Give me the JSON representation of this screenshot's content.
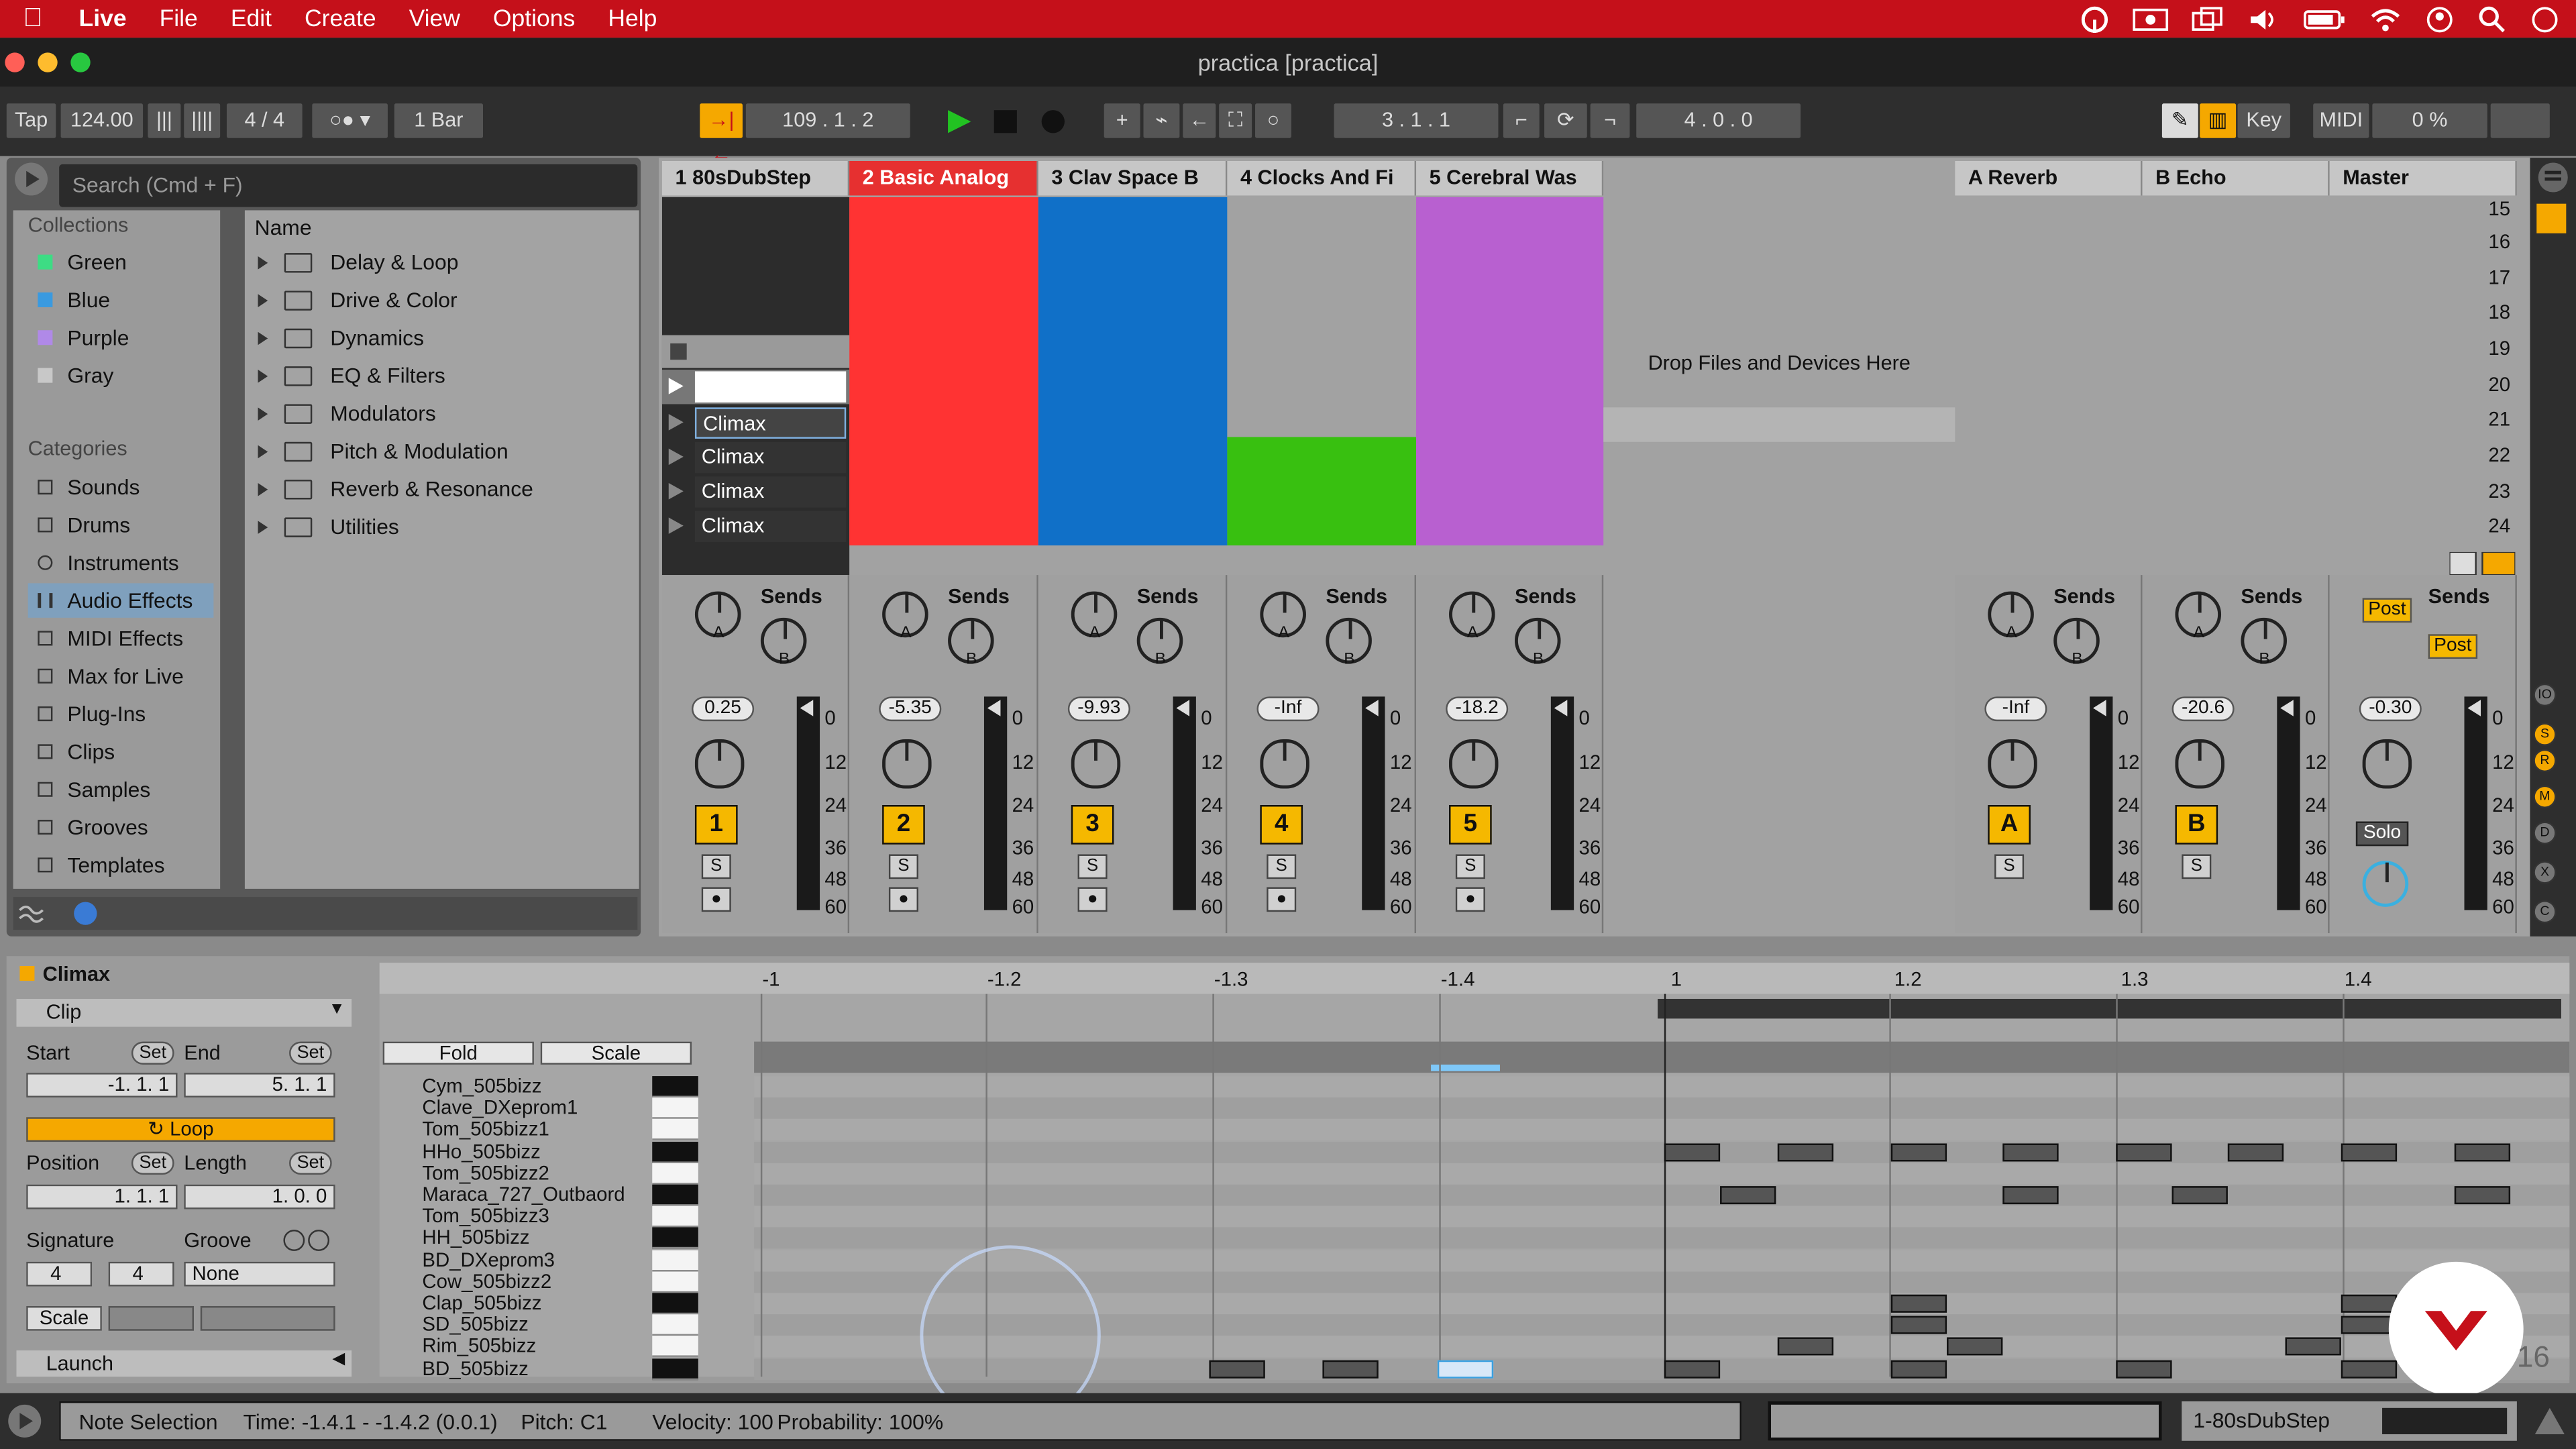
{
  "menubar": {
    "app": "Live",
    "items": [
      "File",
      "Edit",
      "Create",
      "View",
      "Options",
      "Help"
    ]
  },
  "window": {
    "title": "practica  [practica]"
  },
  "control_bar": {
    "tap": "Tap",
    "tempo": "124.00",
    "signature": "4 / 4",
    "quantize": "1 Bar",
    "position": "109 .  1 .  2",
    "loop_start": "3 .  1 .  1",
    "loop_length": "4 .  0 .  0",
    "key": "Key",
    "midi": "MIDI",
    "cpu": "0 %"
  },
  "browser": {
    "search_placeholder": "Search (Cmd + F)",
    "collections_title": "Collections",
    "collections": [
      {
        "label": "Green",
        "color": "#3ddc84"
      },
      {
        "label": "Blue",
        "color": "#3a9ae0"
      },
      {
        "label": "Purple",
        "color": "#b089e8"
      },
      {
        "label": "Gray",
        "color": "#c8c8c8"
      }
    ],
    "categories_title": "Categories",
    "categories": [
      "Sounds",
      "Drums",
      "Instruments",
      "Audio Effects",
      "MIDI Effects",
      "Max for Live",
      "Plug-Ins",
      "Clips",
      "Samples",
      "Grooves",
      "Templates"
    ],
    "selected_category": "Audio Effects",
    "name_header": "Name",
    "folders": [
      "Delay & Loop",
      "Drive & Color",
      "Dynamics",
      "EQ & Filters",
      "Modulators",
      "Pitch & Modulation",
      "Reverb & Resonance",
      "Utilities"
    ]
  },
  "session": {
    "tracks": [
      {
        "name": "1 80sDubStep",
        "volume": "0.25",
        "number": "1"
      },
      {
        "name": "2 Basic Analog",
        "volume": "-5.35",
        "number": "2"
      },
      {
        "name": "3 Clav Space B",
        "volume": "-9.93",
        "number": "3"
      },
      {
        "name": "4 Clocks And Fi",
        "volume": "-Inf",
        "number": "4"
      },
      {
        "name": "5 Cerebral Was",
        "volume": "-18.2",
        "number": "5"
      }
    ],
    "clip_names": [
      "Climax",
      "Climax",
      "Climax",
      "Climax"
    ],
    "drop_text": "Drop Files and Devices Here",
    "returns": [
      {
        "name": "A Reverb",
        "volume": "-Inf",
        "letter": "A"
      },
      {
        "name": "B Echo",
        "volume": "-20.6",
        "letter": "B"
      }
    ],
    "master": {
      "name": "Master",
      "volume": "-0.30",
      "solo": "Solo",
      "post1": "Post",
      "post2": "Post"
    },
    "scene_numbers": [
      "15",
      "16",
      "17",
      "18",
      "19",
      "20",
      "21",
      "22",
      "23",
      "24"
    ],
    "sends": "Sends",
    "meter_scale": [
      "0",
      "12",
      "24",
      "36",
      "48",
      "60"
    ],
    "solo_btn": "S"
  },
  "clip_detail": {
    "clip_name": "Climax",
    "clip_header": "Clip",
    "start_label": "Start",
    "end_label": "End",
    "set": "Set",
    "start_value": "-1.  1.  1",
    "end_value": "5.  1.  1",
    "loop": "Loop",
    "position_label": "Position",
    "length_label": "Length",
    "position_value": "1.  1.  1",
    "length_value": "1.  0.  0",
    "signature_label": "Signature",
    "groove_label": "Groove",
    "sig_num": "4",
    "sig_den": "4",
    "groove_value": "None",
    "scale_btn": "Scale",
    "launch": "Launch"
  },
  "piano_roll": {
    "fold": "Fold",
    "scale": "Scale",
    "ruler": [
      "-1",
      "-1.2",
      "-1.3",
      "-1.4",
      "1",
      "1.2",
      "1.3",
      "1.4"
    ],
    "notes": [
      "Cym_505bizz",
      "Clave_DXeprom1",
      "Tom_505bizz1",
      "HHo_505bizz",
      "Tom_505bizz2",
      "Maraca_727_Outbaord",
      "Tom_505bizz3",
      "HH_505bizz",
      "BD_DXeprom3",
      "Cow_505bizz2",
      "Clap_505bizz",
      "SD_505bizz",
      "Rim_505bizz",
      "BD_505bizz"
    ],
    "page": "16"
  },
  "status": {
    "selection": "Note Selection",
    "time": "Time: -1.4.1 - -1.4.2 (0.0.1)",
    "pitch": "Pitch: C1",
    "velocity": "Velocity: 100",
    "probability": "Probability: 100%",
    "track": "1-80sDubStep"
  }
}
